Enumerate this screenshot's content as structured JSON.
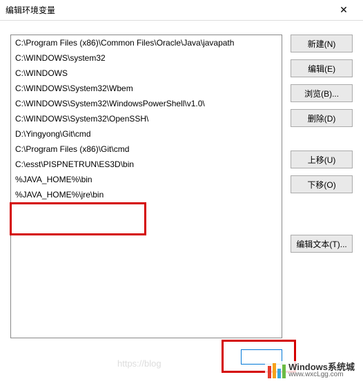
{
  "window": {
    "title": "编辑环境变量",
    "close": "✕"
  },
  "list": {
    "items": [
      "C:\\Program Files (x86)\\Common Files\\Oracle\\Java\\javapath",
      "C:\\WINDOWS\\system32",
      "C:\\WINDOWS",
      "C:\\WINDOWS\\System32\\Wbem",
      "C:\\WINDOWS\\System32\\WindowsPowerShell\\v1.0\\",
      "C:\\WINDOWS\\System32\\OpenSSH\\",
      "D:\\Yingyong\\Git\\cmd",
      "C:\\Program Files (x86)\\Git\\cmd",
      "C:\\esst\\PISPNETRUN\\ES3D\\bin",
      "%JAVA_HOME%\\bin",
      "%JAVA_HOME%\\jre\\bin"
    ]
  },
  "buttons": {
    "new": "新建(N)",
    "edit": "编辑(E)",
    "browse": "浏览(B)...",
    "delete": "删除(D)",
    "moveup": "上移(U)",
    "movedown": "下移(O)",
    "edittext": "编辑文本(T)..."
  },
  "watermark": {
    "line1": "Windows系统城",
    "line2": "www.wxcLgg.com",
    "faint": "https://blog"
  }
}
